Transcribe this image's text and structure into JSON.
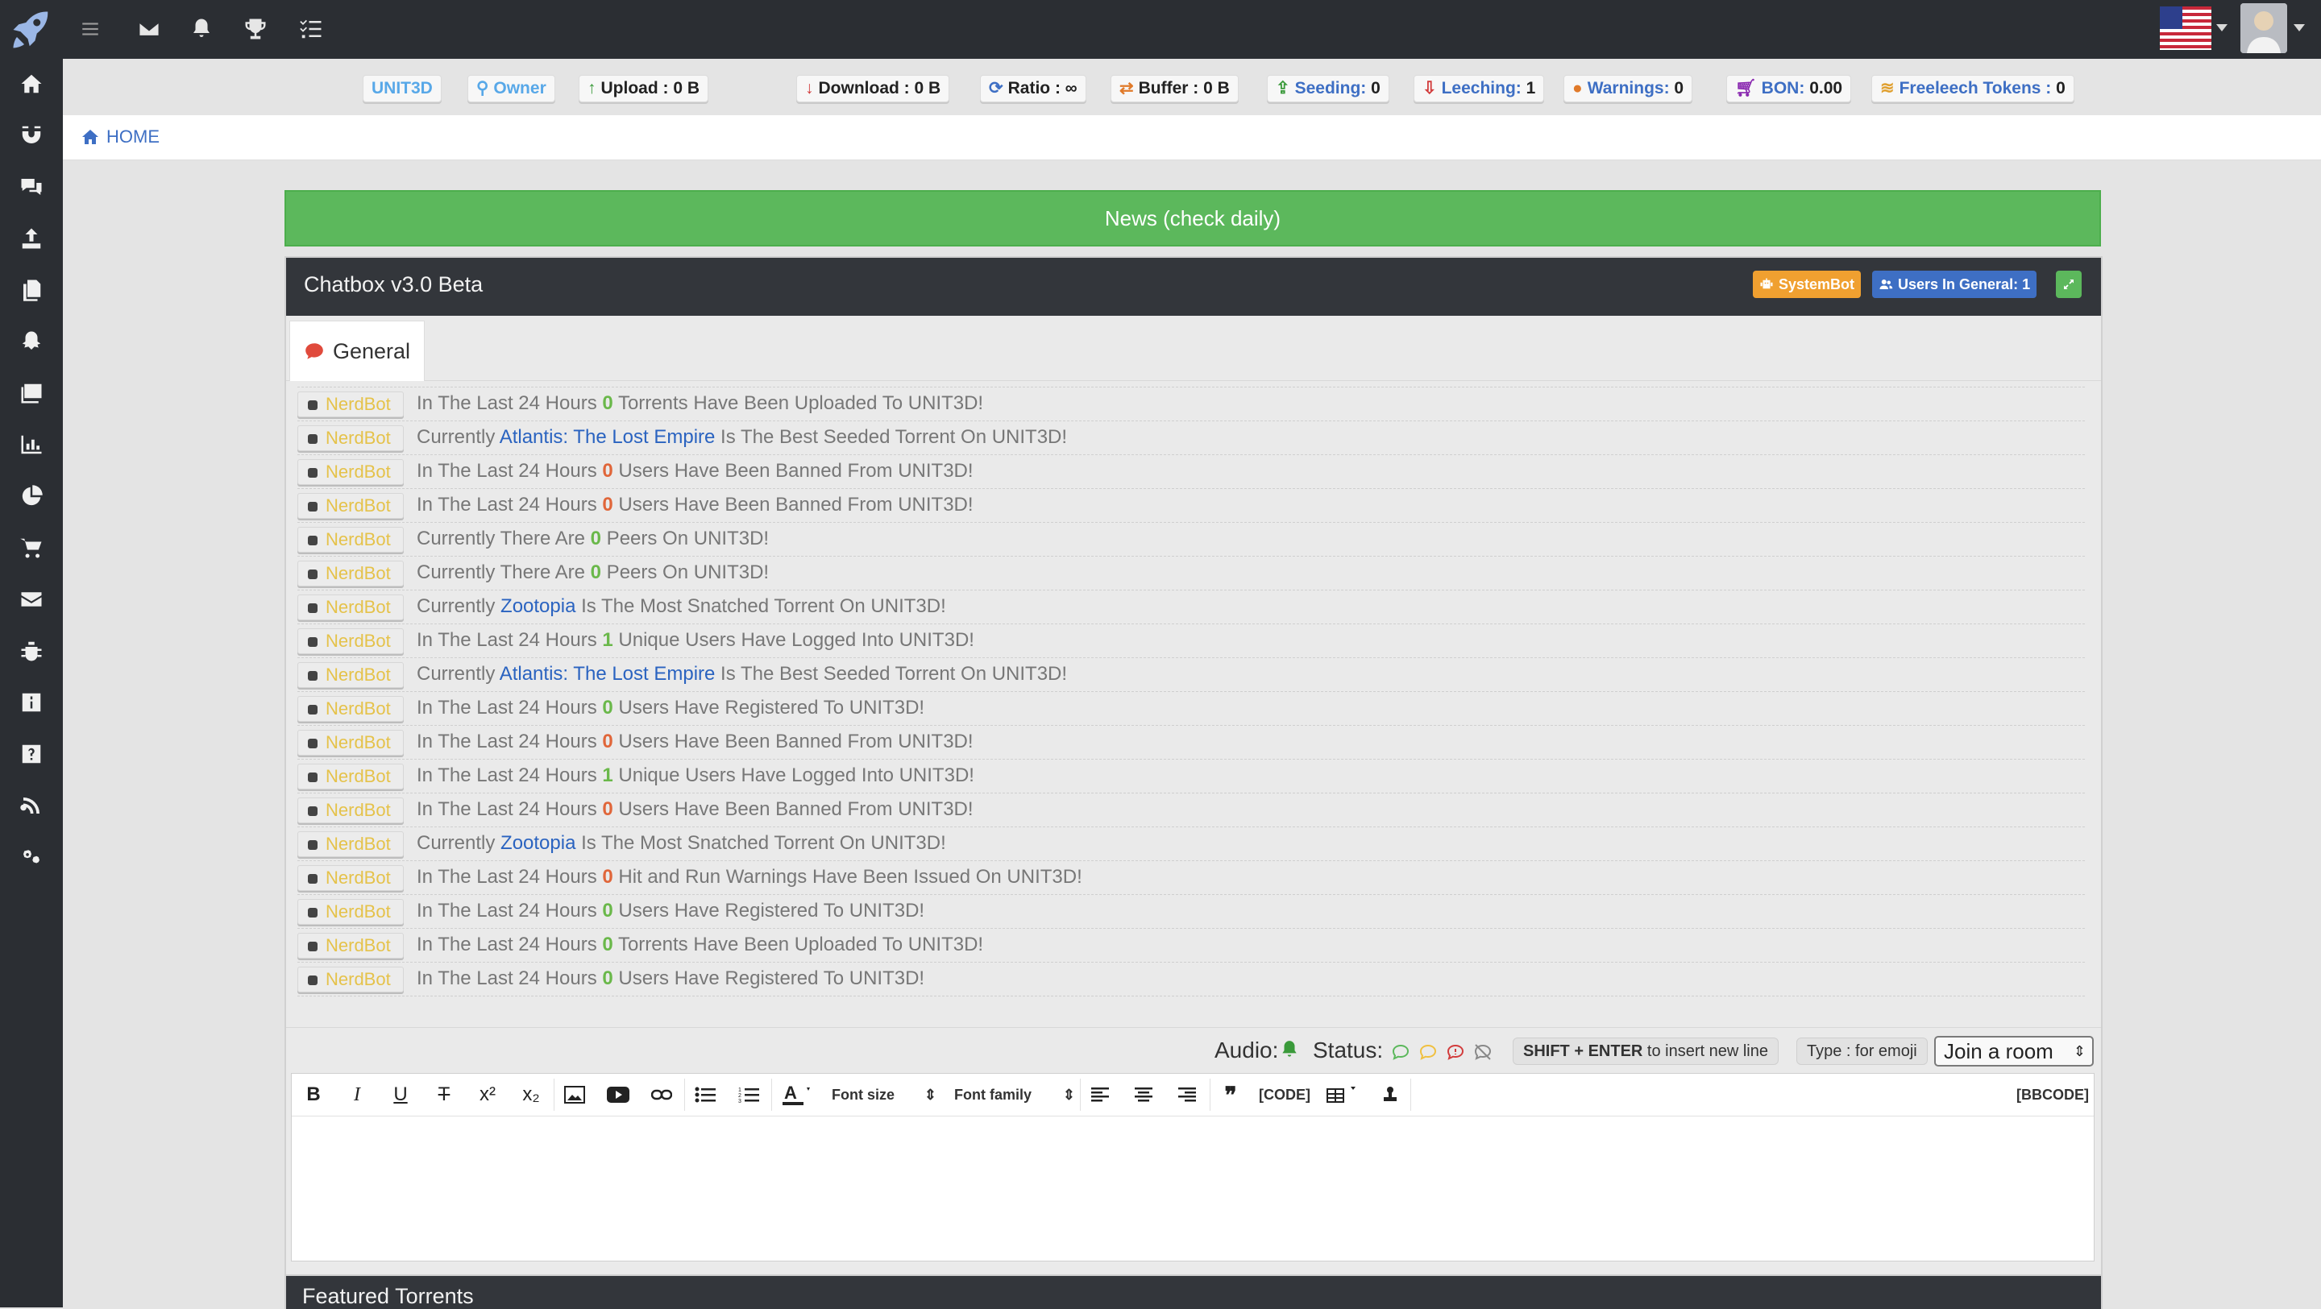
{
  "topbar": {
    "icons": [
      "menu-icon",
      "envelope-icon",
      "bell-icon",
      "trophy-icon",
      "tasks-icon"
    ]
  },
  "sidebar": {
    "icons": [
      "home-icon",
      "magnet-icon",
      "comments-icon",
      "upload-icon",
      "files-icon",
      "snapchat-ghost-icon",
      "images-icon",
      "bar-chart-icon",
      "pie-chart-icon",
      "cart-icon",
      "envelope-icon",
      "bug-icon",
      "info-icon",
      "question-icon",
      "rss-icon",
      "cogs-icon"
    ]
  },
  "stats": {
    "site": "UNIT3D",
    "group": "Owner",
    "upload_label": "Upload :",
    "upload_value": "0 B",
    "download_label": "Download :",
    "download_value": "0 B",
    "ratio_label": "Ratio :",
    "ratio_value": "∞",
    "buffer_label": "Buffer :",
    "buffer_value": "0 B",
    "seeding_label": "Seeding:",
    "seeding_value": "0",
    "leeching_label": "Leeching:",
    "leeching_value": "1",
    "warnings_label": "Warnings:",
    "warnings_value": "0",
    "bon_label": "BON:",
    "bon_value": "0.00",
    "freeleech_label": "Freeleech Tokens :",
    "freeleech_value": "0"
  },
  "breadcrumb": {
    "home": "HOME"
  },
  "news": {
    "title": "News (check daily)"
  },
  "chatbox": {
    "title": "Chatbox v3.0 Beta",
    "systembot": "SystemBot",
    "users_in_general": "Users In General: 1",
    "tab_general": "General",
    "messages": [
      {
        "bot": "NerdBot",
        "pre": "In The Last 24 Hours ",
        "num": "0",
        "post": " Torrents Have Been Uploaded To UNIT3D!",
        "numcolor": "green"
      },
      {
        "bot": "NerdBot",
        "pre": "Currently ",
        "link": "Atlantis: The Lost Empire",
        "post": " Is The Best Seeded Torrent On UNIT3D!"
      },
      {
        "bot": "NerdBot",
        "pre": "In The Last 24 Hours ",
        "num": "0",
        "post": " Users Have Been Banned From UNIT3D!",
        "numcolor": "red"
      },
      {
        "bot": "NerdBot",
        "pre": "In The Last 24 Hours ",
        "num": "0",
        "post": " Users Have Been Banned From UNIT3D!",
        "numcolor": "red"
      },
      {
        "bot": "NerdBot",
        "pre": "Currently There Are ",
        "num": "0",
        "post": " Peers On UNIT3D!",
        "numcolor": "green"
      },
      {
        "bot": "NerdBot",
        "pre": "Currently There Are ",
        "num": "0",
        "post": " Peers On UNIT3D!",
        "numcolor": "green"
      },
      {
        "bot": "NerdBot",
        "pre": "Currently ",
        "link": "Zootopia",
        "post": " Is The Most Snatched Torrent On UNIT3D!"
      },
      {
        "bot": "NerdBot",
        "pre": "In The Last 24 Hours ",
        "num": "1",
        "post": " Unique Users Have Logged Into UNIT3D!",
        "numcolor": "green"
      },
      {
        "bot": "NerdBot",
        "pre": "Currently ",
        "link": "Atlantis: The Lost Empire",
        "post": " Is The Best Seeded Torrent On UNIT3D!"
      },
      {
        "bot": "NerdBot",
        "pre": "In The Last 24 Hours ",
        "num": "0",
        "post": " Users Have Registered To UNIT3D!",
        "numcolor": "green"
      },
      {
        "bot": "NerdBot",
        "pre": "In The Last 24 Hours ",
        "num": "0",
        "post": " Users Have Been Banned From UNIT3D!",
        "numcolor": "red"
      },
      {
        "bot": "NerdBot",
        "pre": "In The Last 24 Hours ",
        "num": "1",
        "post": " Unique Users Have Logged Into UNIT3D!",
        "numcolor": "green"
      },
      {
        "bot": "NerdBot",
        "pre": "In The Last 24 Hours ",
        "num": "0",
        "post": " Users Have Been Banned From UNIT3D!",
        "numcolor": "red"
      },
      {
        "bot": "NerdBot",
        "pre": "Currently ",
        "link": "Zootopia",
        "post": " Is The Most Snatched Torrent On UNIT3D!"
      },
      {
        "bot": "NerdBot",
        "pre": "In The Last 24 Hours ",
        "num": "0",
        "post": " Hit and Run Warnings Have Been Issued On UNIT3D!",
        "numcolor": "red"
      },
      {
        "bot": "NerdBot",
        "pre": "In The Last 24 Hours ",
        "num": "0",
        "post": " Users Have Registered To UNIT3D!",
        "numcolor": "green"
      },
      {
        "bot": "NerdBot",
        "pre": "In The Last 24 Hours ",
        "num": "0",
        "post": " Torrents Have Been Uploaded To UNIT3D!",
        "numcolor": "green"
      },
      {
        "bot": "NerdBot",
        "pre": "In The Last 24 Hours ",
        "num": "0",
        "post": " Users Have Registered To UNIT3D!",
        "numcolor": "green"
      }
    ],
    "audio_label": "Audio:",
    "status_label": "Status:",
    "shift_hint_bold": "SHIFT + ENTER",
    "shift_hint_rest": " to insert new line",
    "emoji_hint": "Type : for emoji",
    "room_select": "Join a room"
  },
  "editor": {
    "font_size": "Font size",
    "font_family": "Font family",
    "code": "[CODE]",
    "bbcode": "[BBCODE]",
    "bold": "B",
    "italic": "I",
    "underline": "U",
    "strike": "T",
    "superscript": "x²",
    "subscript": "x₂"
  },
  "featured": {
    "title": "Featured Torrents"
  },
  "colors": {
    "accent_blue": "#2a63c0",
    "news_green": "#5cb85c",
    "bot_yellow": "#e5c24a",
    "systembot_orange": "#f0a030",
    "users_blue": "#3e6fc4"
  }
}
